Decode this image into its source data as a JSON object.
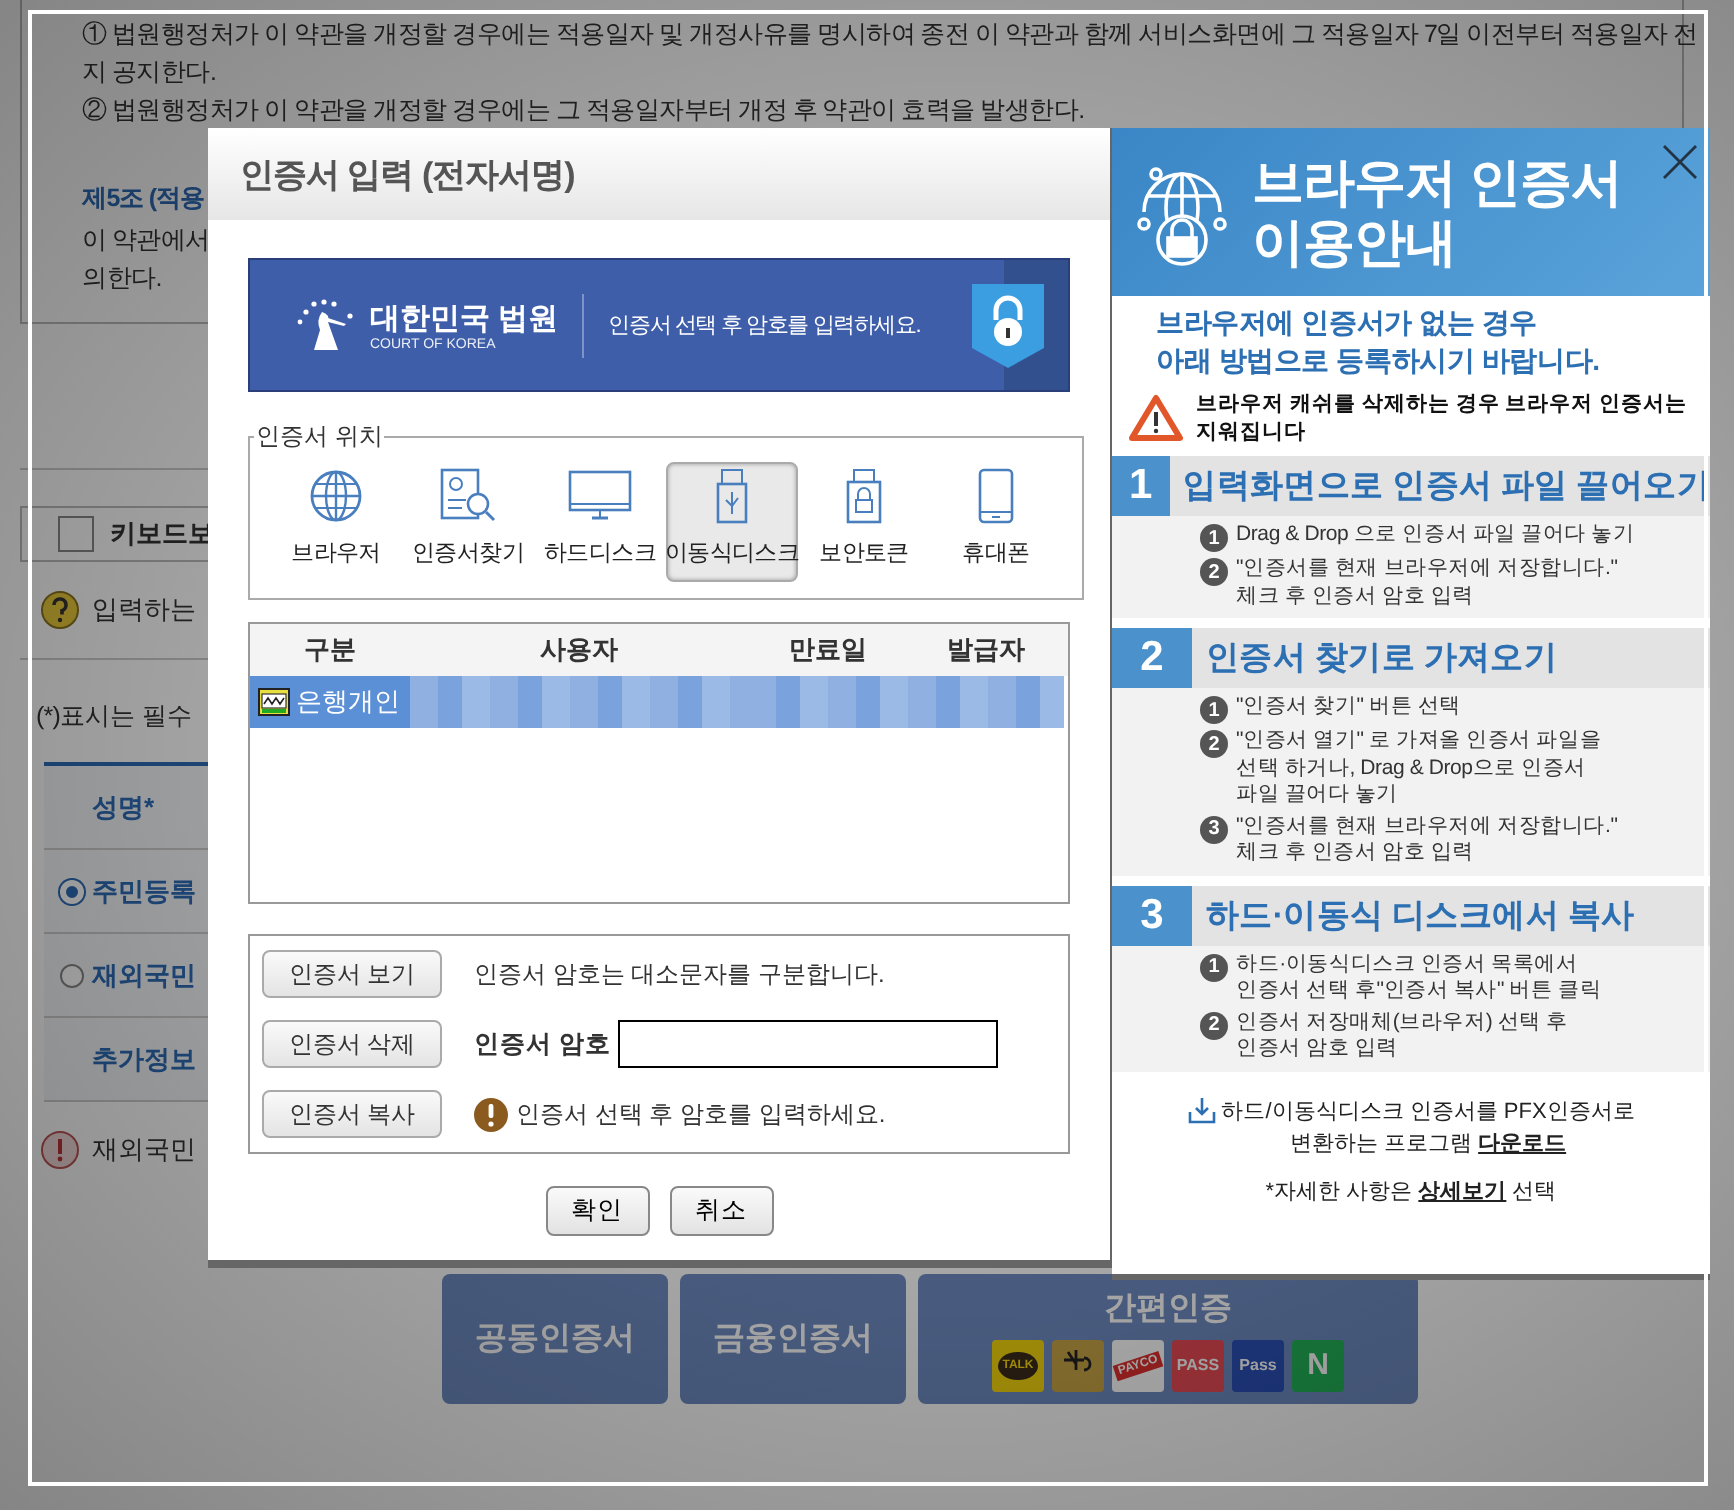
{
  "background_page": {
    "terms": [
      {
        "kind": "text",
        "text": "① 법원행정처가 이 약관을 개정할 경우에는 적용일자 및 개정사유를 명시하여 종전 이 약관과 함께 서비스화면에 그 적용일자 7일 이전부터 적용일자 전"
      },
      {
        "kind": "text",
        "text": "지 공지한다."
      },
      {
        "kind": "text",
        "text": "② 법원행정처가 이 약관을 개정할 경우에는 그 적용일자부터 개정 후 약관이 효력을 발생한다."
      },
      {
        "kind": "heading",
        "text": "제5조 (적용"
      },
      {
        "kind": "text",
        "text": "이 약관에서"
      },
      {
        "kind": "text",
        "text": "의한다."
      }
    ],
    "keyboard_option": {
      "label": "키보드보",
      "checked": false
    },
    "help_note": "입력하는",
    "required_note": "(*)표시는 필수",
    "form_rows": [
      {
        "kind": "label",
        "label": "성명*"
      },
      {
        "kind": "radio",
        "label": "주민등록",
        "selected": true
      },
      {
        "kind": "radio",
        "label": "재외국민",
        "selected": false
      },
      {
        "kind": "label",
        "label": "추가정보"
      }
    ],
    "warning_note": "재외국민",
    "auth_buttons": [
      {
        "kind": "text",
        "label": "공동인증서"
      },
      {
        "kind": "text",
        "label": "금융인증서"
      },
      {
        "kind": "logos",
        "label": "간편인증",
        "logos": [
          {
            "kind": "talk",
            "text": "TALK"
          },
          {
            "kind": "kb"
          },
          {
            "kind": "payco",
            "text": "PAYCO"
          },
          {
            "kind": "pass",
            "text": "PASS"
          },
          {
            "kind": "samsung",
            "text": "Pass"
          },
          {
            "kind": "naver",
            "text": "N"
          }
        ]
      }
    ]
  },
  "dialog": {
    "title": "인증서 입력 (전자서명)",
    "banner": {
      "logo_title": "대한민국 법원",
      "logo_subtitle": "COURT OF KOREA",
      "message": "인증서 선택 후 암호를 입력하세요."
    },
    "location_group": {
      "legend": "인증서 위치",
      "options": [
        {
          "kind": "browser",
          "label": "브라우저",
          "selected": false
        },
        {
          "kind": "search",
          "label": "인증서찾기",
          "selected": false
        },
        {
          "kind": "harddisk",
          "label": "하드디스크",
          "selected": false
        },
        {
          "kind": "usb",
          "label": "이동식디스크",
          "selected": true
        },
        {
          "kind": "token",
          "label": "보안토큰",
          "selected": false
        },
        {
          "kind": "phone",
          "label": "휴대폰",
          "selected": false
        }
      ]
    },
    "table": {
      "columns": [
        "구분",
        "사용자",
        "만료일",
        "발급자"
      ],
      "rows": [
        {
          "type": "은행개인",
          "selected": true
        }
      ]
    },
    "actions": [
      {
        "button": "인증서 보기",
        "kind": "note",
        "text": "인증서 암호는 대소문자를 구분합니다."
      },
      {
        "button": "인증서 삭제",
        "kind": "password",
        "text": "인증서 암호"
      },
      {
        "button": "인증서 복사",
        "kind": "warning",
        "text": "인증서 선택 후 암호를 입력하세요."
      }
    ],
    "buttons": [
      "확인",
      "취소"
    ]
  },
  "guide_panel": {
    "title_lines": [
      "브라우저 인증서",
      "이용안내"
    ],
    "intro": "브라우저에 인증서가 없는 경우\n아래 방법으로 등록하시기 바랍니다.",
    "warning": "브라우저 캐쉬를 삭제하는 경우 브라우저 인증서는\n지워집니다",
    "sections": [
      {
        "number": "1",
        "title": "입력화면으로 인증서 파일 끌어오기",
        "steps": [
          {
            "number": "1",
            "text": "Drag & Drop 으로 인증서 파일 끌어다 놓기"
          },
          {
            "number": "2",
            "text": "\"인증서를 현재 브라우저에 저장합니다.\"\n체크 후 인증서 암호 입력"
          }
        ]
      },
      {
        "number": "2",
        "title": "인증서 찾기로 가져오기",
        "steps": [
          {
            "number": "1",
            "text": "\"인증서 찾기\" 버튼 선택"
          },
          {
            "number": "2",
            "text": "\"인증서 열기\" 로 가져올 인증서 파일을\n선택 하거나, Drag & Drop으로 인증서\n파일 끌어다 놓기"
          },
          {
            "number": "3",
            "text": "\"인증서를 현재 브라우저에 저장합니다.\"\n체크 후 인증서 암호 입력"
          }
        ]
      },
      {
        "number": "3",
        "title": "하드·이동식 디스크에서 복사",
        "steps": [
          {
            "number": "1",
            "text": "하드·이동식디스크 인증서 목록에서\n인증서 선택 후\"인증서 복사\" 버튼 클릭"
          },
          {
            "number": "2",
            "text": "인증서 저장매체(브라우저) 선택 후\n인증서 암호 입력"
          }
        ]
      }
    ],
    "download": {
      "text": "하드/이동식디스크 인증서를 PFX인증서로\n변환하는 프로그램",
      "link": "다운로드"
    },
    "footer": {
      "before": "*자세한 사항은",
      "link": "상세보기",
      "after": "선택"
    }
  }
}
